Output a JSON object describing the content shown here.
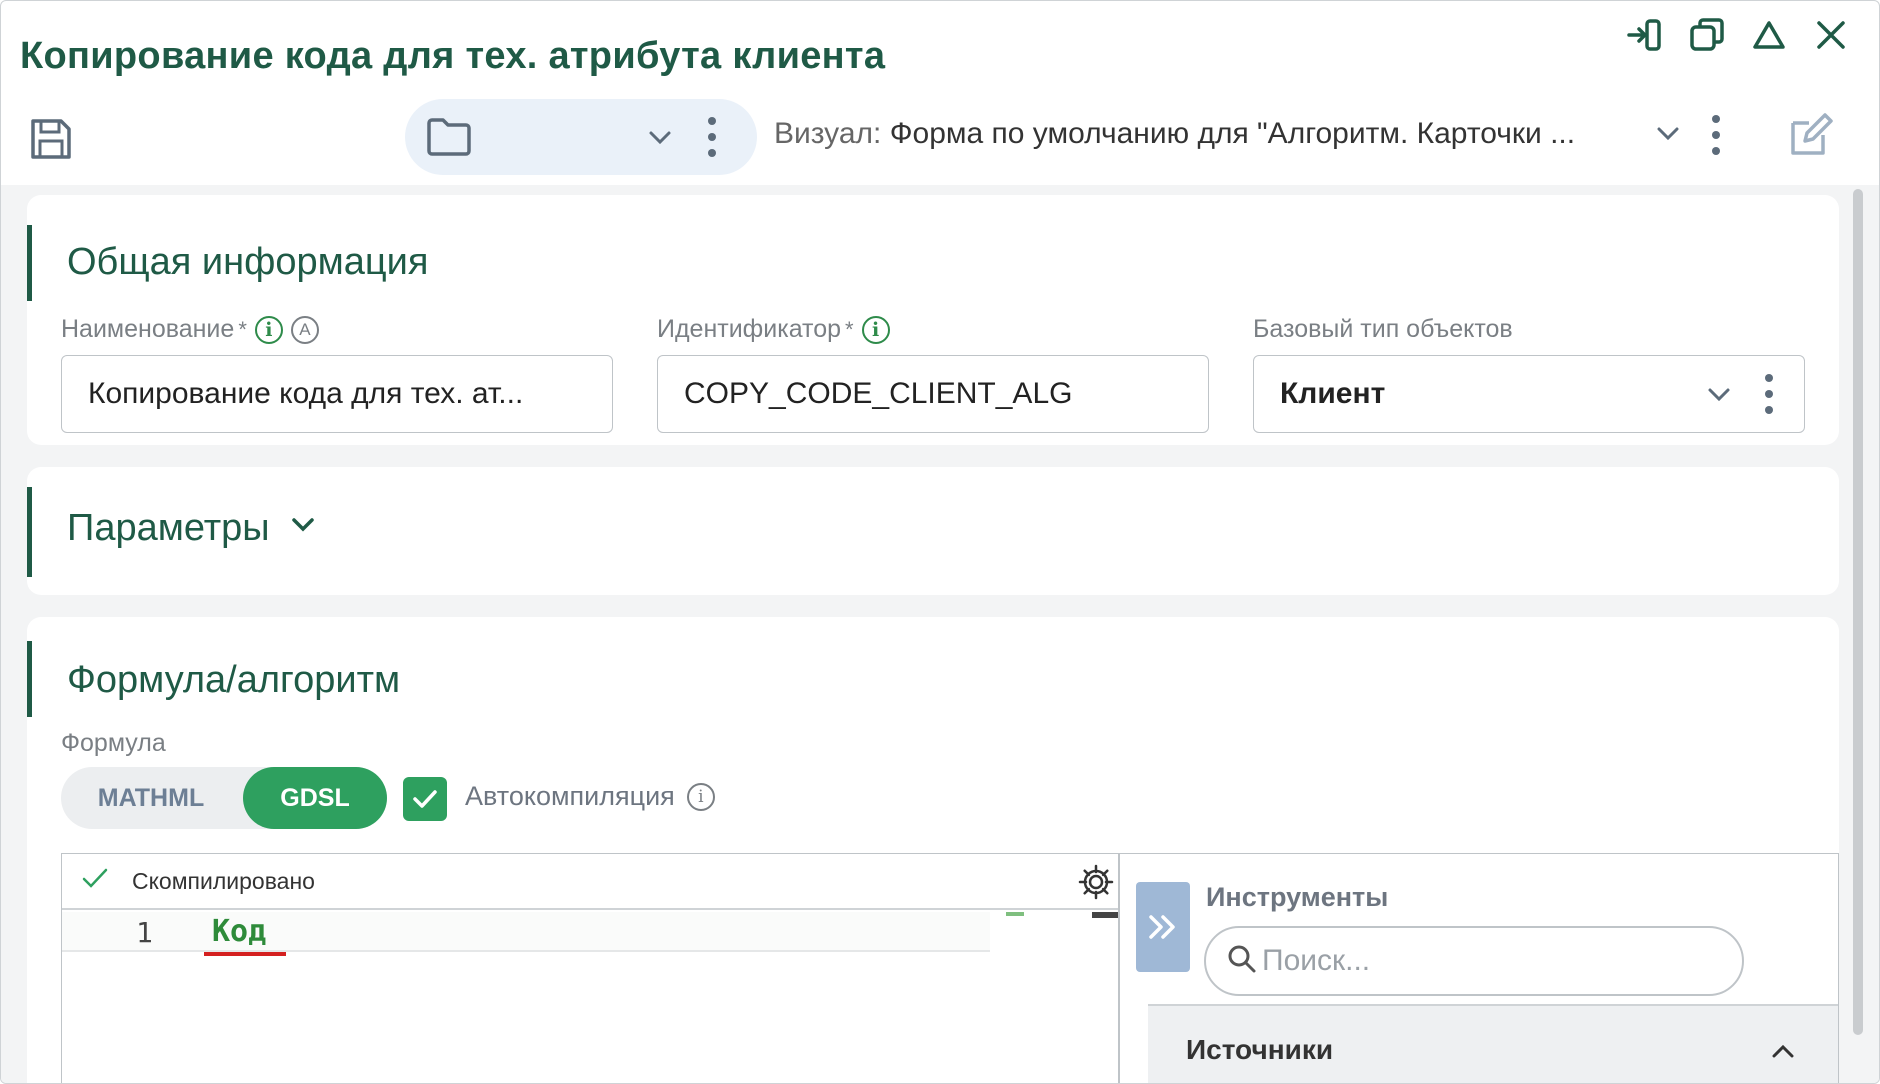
{
  "window": {
    "title": "Копирование кода для тех. атрибута клиента",
    "controls": [
      "exit-icon",
      "restore-icon",
      "home-icon",
      "close-icon"
    ]
  },
  "toolbar": {
    "visual_label": "Визуал:",
    "visual_value": "Форма по умолчанию для \"Алгоритм. Карточки ..."
  },
  "general": {
    "title": "Общая информация",
    "name_label": "Наименование",
    "name_value": "Копирование кода для тех. ат...",
    "id_label": "Идентификатор",
    "id_value": "COPY_CODE_CLIENT_ALG",
    "base_type_label": "Базовый тип объектов",
    "base_type_value": "Клиент",
    "required_mark": "*",
    "info_mark": "i",
    "auto_mark": "A"
  },
  "params": {
    "title": "Параметры"
  },
  "formula": {
    "title": "Формула/алгоритм",
    "label": "Формула",
    "toggle": [
      "MATHML",
      "GDSL"
    ],
    "active": "GDSL",
    "autocompile_label": "Автокомпиляция",
    "autocompile_checked": true,
    "editor": {
      "status": "Скомпилировано",
      "lines": [
        {
          "no": "1",
          "text": "Код"
        }
      ]
    },
    "tools": {
      "title": "Инструменты",
      "search_placeholder": "Поиск...",
      "sources_label": "Источники"
    }
  },
  "colors": {
    "accent": "#1f5a46",
    "active_toggle": "#2ea05f",
    "error_underline": "#d42020"
  }
}
